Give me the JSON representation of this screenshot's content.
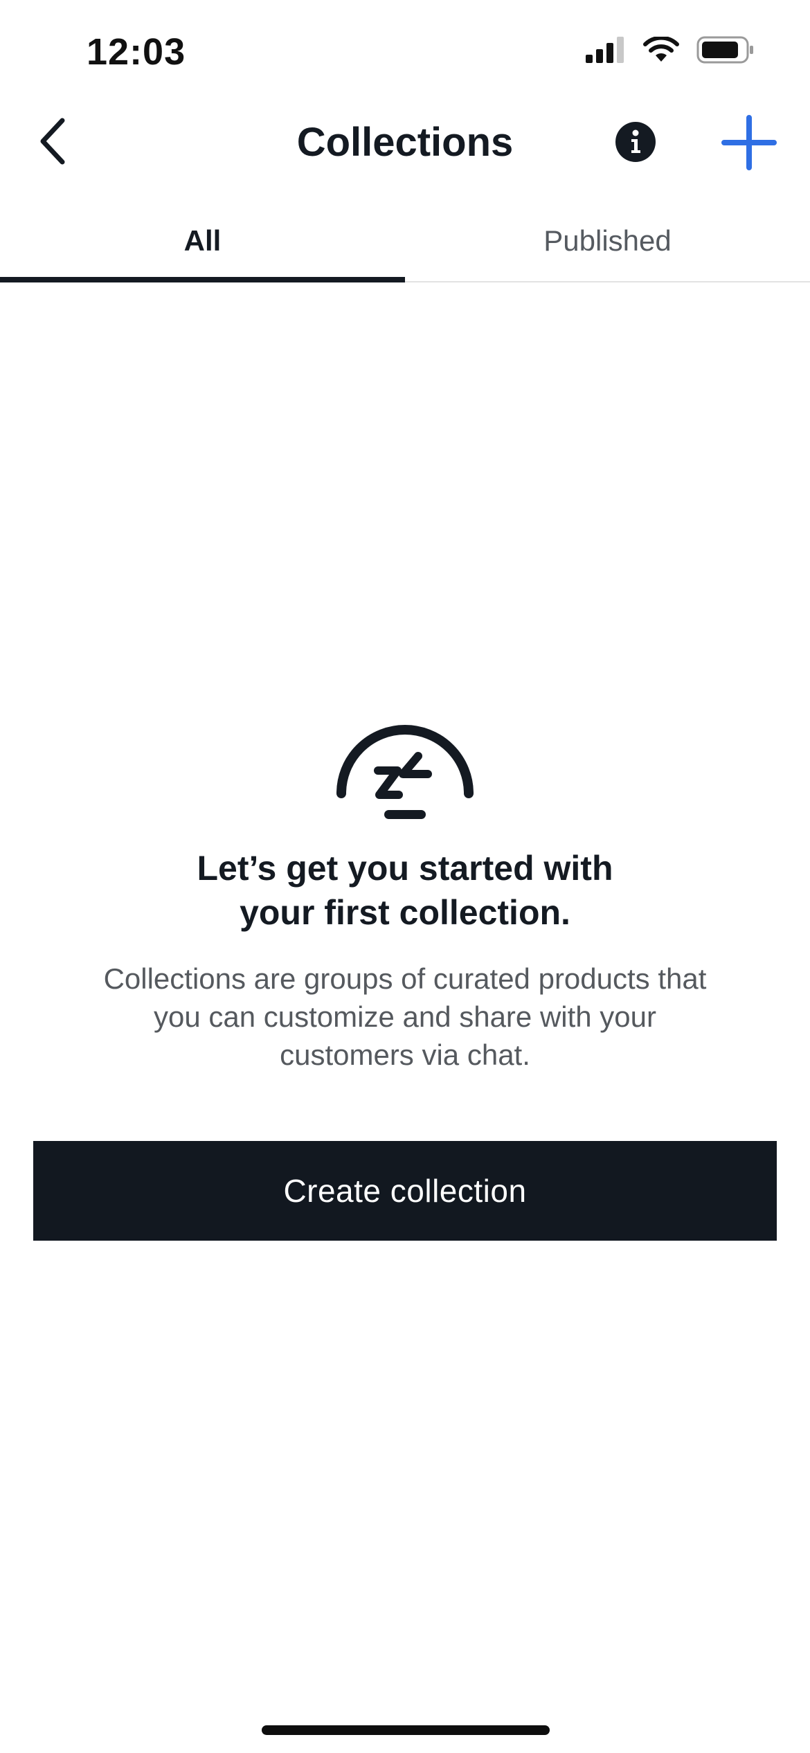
{
  "status_bar": {
    "time": "12:03",
    "icons": [
      "cellular-signal-icon",
      "wifi-icon",
      "battery-icon"
    ]
  },
  "nav": {
    "title": "Collections",
    "back_icon": "chevron-left-icon",
    "info_icon": "info-icon",
    "add_icon": "plus-icon"
  },
  "tabs": [
    {
      "label": "All",
      "selected": true
    },
    {
      "label": "Published",
      "selected": false
    }
  ],
  "empty_state": {
    "icon": "sleeping-dome-icon",
    "heading_line1": "Let’s get you started with",
    "heading_line2": "your first collection.",
    "body_line1": "Collections are groups of curated products that",
    "body_line2": "you can customize and share with your",
    "body_line3": "customers via chat.",
    "button_label": "Create collection"
  },
  "colors": {
    "primary_dark": "#121820",
    "accent_blue": "#2f6fe4",
    "muted_text": "#55595e",
    "background": "#ffffff"
  }
}
